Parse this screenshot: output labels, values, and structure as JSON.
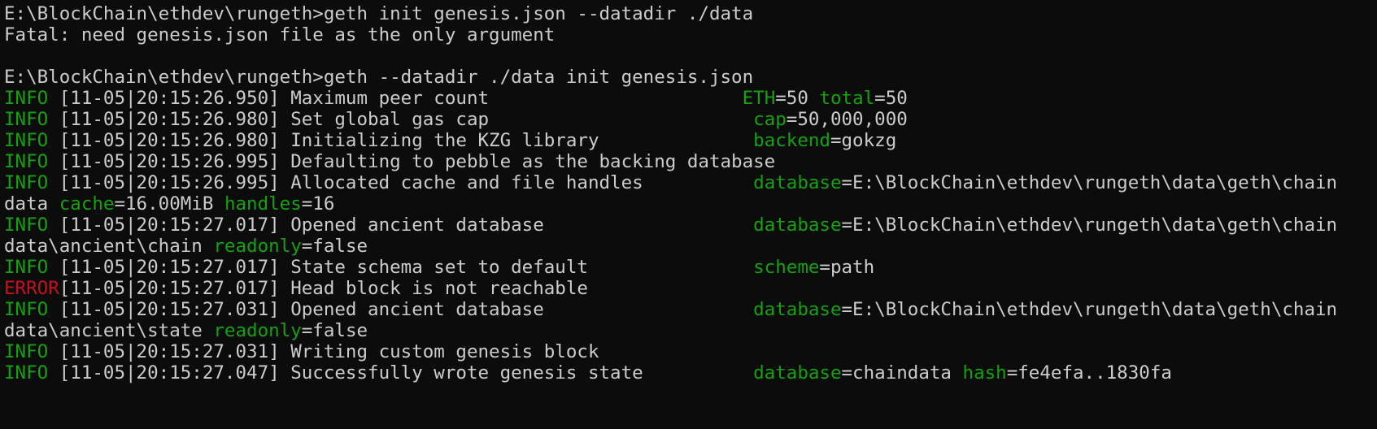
{
  "colors": {
    "background": "#0c0c0c",
    "text": "#cccccc",
    "info_green": "#13a10e",
    "error_red": "#c50f1f"
  },
  "lines": [
    [
      {
        "t": "E:\\BlockChain\\ethdev\\rungeth>geth init genesis.json --datadir ./data",
        "c": "t"
      }
    ],
    [
      {
        "t": "Fatal: need genesis.json file as the only argument",
        "c": "t"
      }
    ],
    [],
    [
      {
        "t": "E:\\BlockChain\\ethdev\\rungeth>geth --datadir ./data init genesis.json",
        "c": "t"
      }
    ],
    [
      {
        "t": "INFO",
        "c": "g"
      },
      {
        "t": " [11-05|20:15:26.950] Maximum peer count                       ",
        "c": "t"
      },
      {
        "t": "ETH",
        "c": "g"
      },
      {
        "t": "=50 ",
        "c": "t"
      },
      {
        "t": "total",
        "c": "g"
      },
      {
        "t": "=50",
        "c": "t"
      }
    ],
    [
      {
        "t": "INFO",
        "c": "g"
      },
      {
        "t": " [11-05|20:15:26.980] Set global gas cap                        ",
        "c": "t"
      },
      {
        "t": "cap",
        "c": "g"
      },
      {
        "t": "=50,000,000",
        "c": "t"
      }
    ],
    [
      {
        "t": "INFO",
        "c": "g"
      },
      {
        "t": " [11-05|20:15:26.980] Initializing the KZG library              ",
        "c": "t"
      },
      {
        "t": "backend",
        "c": "g"
      },
      {
        "t": "=gokzg",
        "c": "t"
      }
    ],
    [
      {
        "t": "INFO",
        "c": "g"
      },
      {
        "t": " [11-05|20:15:26.995] Defaulting to pebble as the backing database",
        "c": "t"
      }
    ],
    [
      {
        "t": "INFO",
        "c": "g"
      },
      {
        "t": " [11-05|20:15:26.995] Allocated cache and file handles          ",
        "c": "t"
      },
      {
        "t": "database",
        "c": "g"
      },
      {
        "t": "=E:\\BlockChain\\ethdev\\rungeth\\data\\geth\\chain",
        "c": "t"
      }
    ],
    [
      {
        "t": "data ",
        "c": "t"
      },
      {
        "t": "cache",
        "c": "g"
      },
      {
        "t": "=16.00MiB ",
        "c": "t"
      },
      {
        "t": "handles",
        "c": "g"
      },
      {
        "t": "=16",
        "c": "t"
      }
    ],
    [
      {
        "t": "INFO",
        "c": "g"
      },
      {
        "t": " [11-05|20:15:27.017] Opened ancient database                   ",
        "c": "t"
      },
      {
        "t": "database",
        "c": "g"
      },
      {
        "t": "=E:\\BlockChain\\ethdev\\rungeth\\data\\geth\\chain",
        "c": "t"
      }
    ],
    [
      {
        "t": "data\\ancient\\chain ",
        "c": "t"
      },
      {
        "t": "readonly",
        "c": "g"
      },
      {
        "t": "=false",
        "c": "t"
      }
    ],
    [
      {
        "t": "INFO",
        "c": "g"
      },
      {
        "t": " [11-05|20:15:27.017] State schema set to default               ",
        "c": "t"
      },
      {
        "t": "scheme",
        "c": "g"
      },
      {
        "t": "=path",
        "c": "t"
      }
    ],
    [
      {
        "t": "ERROR",
        "c": "r"
      },
      {
        "t": "[11-05|20:15:27.017] Head block is not reachable",
        "c": "t"
      }
    ],
    [
      {
        "t": "INFO",
        "c": "g"
      },
      {
        "t": " [11-05|20:15:27.031] Opened ancient database                   ",
        "c": "t"
      },
      {
        "t": "database",
        "c": "g"
      },
      {
        "t": "=E:\\BlockChain\\ethdev\\rungeth\\data\\geth\\chain",
        "c": "t"
      }
    ],
    [
      {
        "t": "data\\ancient\\state ",
        "c": "t"
      },
      {
        "t": "readonly",
        "c": "g"
      },
      {
        "t": "=false",
        "c": "t"
      }
    ],
    [
      {
        "t": "INFO",
        "c": "g"
      },
      {
        "t": " [11-05|20:15:27.031] Writing custom genesis block",
        "c": "t"
      }
    ],
    [
      {
        "t": "INFO",
        "c": "g"
      },
      {
        "t": " [11-05|20:15:27.047] Successfully wrote genesis state          ",
        "c": "t"
      },
      {
        "t": "database",
        "c": "g"
      },
      {
        "t": "=chaindata ",
        "c": "t"
      },
      {
        "t": "hash",
        "c": "g"
      },
      {
        "t": "=fe4efa..1830fa",
        "c": "t"
      }
    ]
  ]
}
